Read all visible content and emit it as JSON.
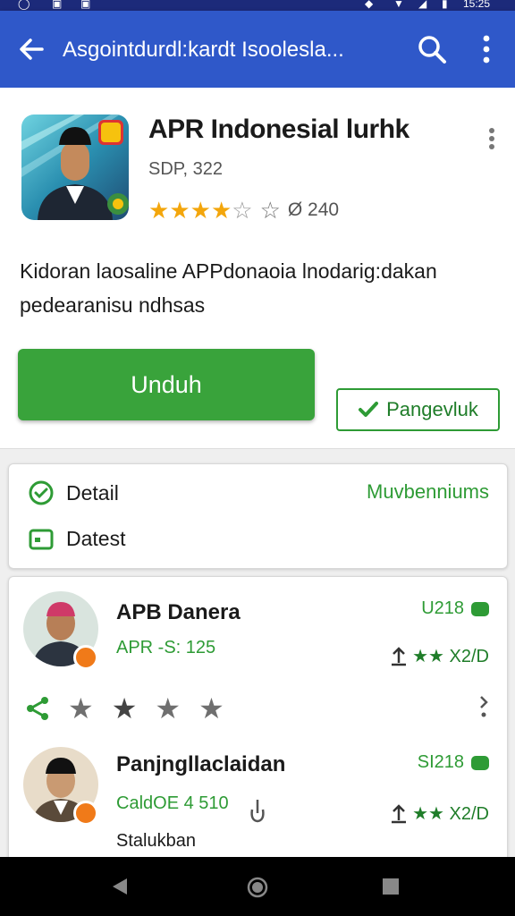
{
  "status": {
    "time": "15:25"
  },
  "appbar": {
    "title": "Asgointdurdl:kardt Isoolesla..."
  },
  "app": {
    "name": "APR Indonesial lurhk",
    "meta": "SDP, 322",
    "rating": 3.5,
    "rating_count": "Ø 240",
    "description": "Kidoran laosaline APPdonaoia lnodarig:dakan pedearanisu ndhsas",
    "install_label": "Unduh",
    "secondary_label": "Pangevluk"
  },
  "details": {
    "item1": "Detail",
    "item2": "Datest",
    "link": "Muvbenniums"
  },
  "reviews": [
    {
      "name": "APB Danera",
      "sub": "APR -S: 125",
      "code": "U218",
      "stars_text": "★★ X2/D",
      "action_stars": 4
    },
    {
      "name": "Panjngllaclaidan",
      "sub": "CaldOE 4 510",
      "code": "SI218",
      "stars_text": "★★ X2/D",
      "third": "Stalukban"
    }
  ],
  "colors": {
    "primary": "#2f58c9",
    "accent": "#39a33b",
    "star": "#f3a60c"
  }
}
